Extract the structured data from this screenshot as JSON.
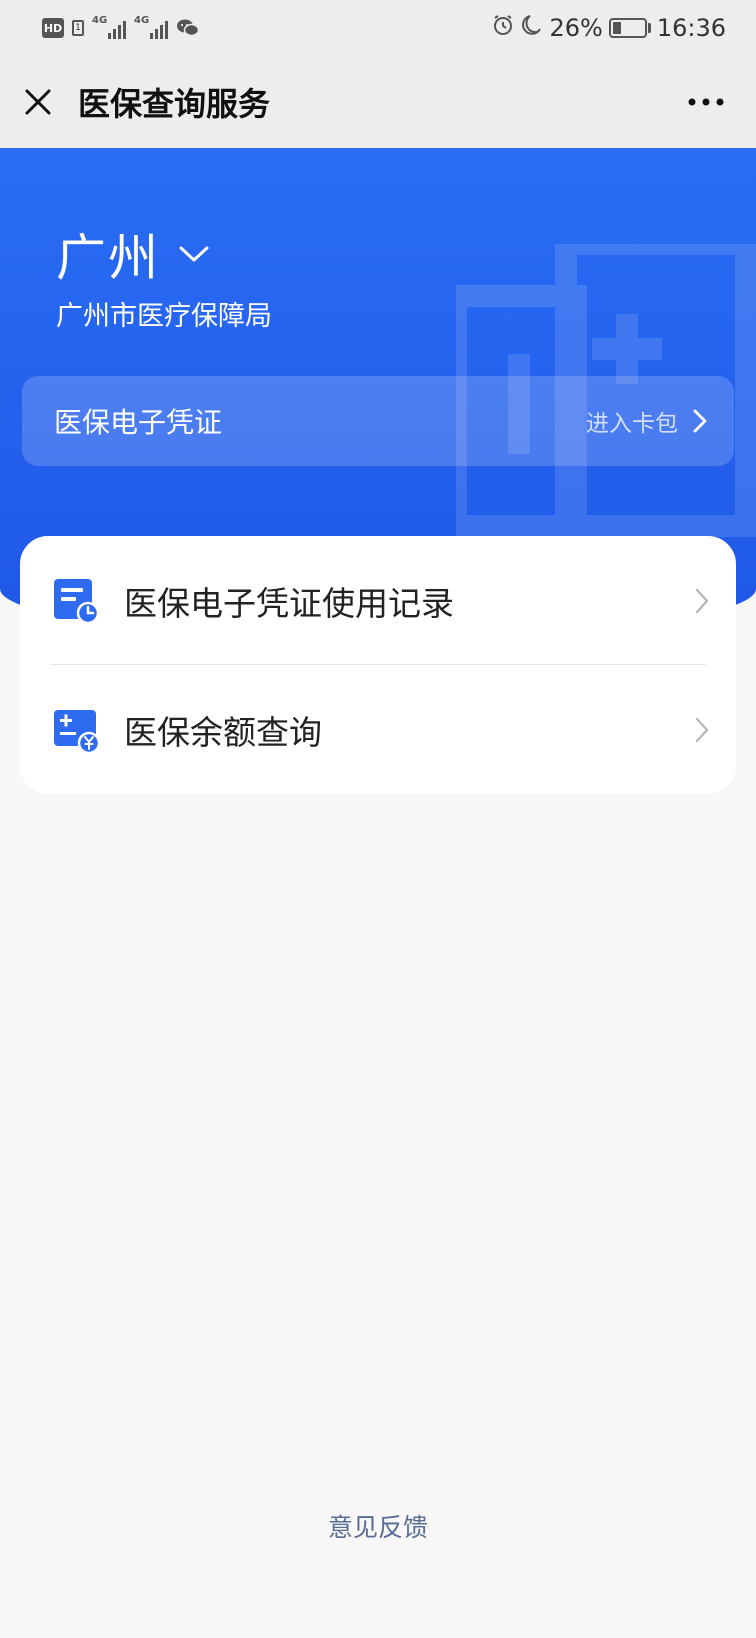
{
  "status_bar": {
    "hd_label": "HD",
    "sim1_label": "1",
    "signal1_tag": "4G",
    "signal2_tag": "4G",
    "battery_percent": "26%",
    "battery_level": 0.26,
    "time": "16:36"
  },
  "nav": {
    "title": "医保查询服务"
  },
  "header": {
    "city": "广州",
    "bureau": "广州市医疗保障局",
    "ecard_label": "医保电子凭证",
    "ecard_link": "进入卡包"
  },
  "menu": {
    "items": [
      {
        "label": "医保电子凭证使用记录",
        "icon": "record-clock-icon"
      },
      {
        "label": "医保余额查询",
        "icon": "balance-yuan-icon"
      }
    ]
  },
  "footer": {
    "feedback": "意见反馈"
  },
  "colors": {
    "header_blue": "#2a6df4",
    "icon_blue": "#2f6bf0",
    "feedback_link": "#586c94"
  }
}
